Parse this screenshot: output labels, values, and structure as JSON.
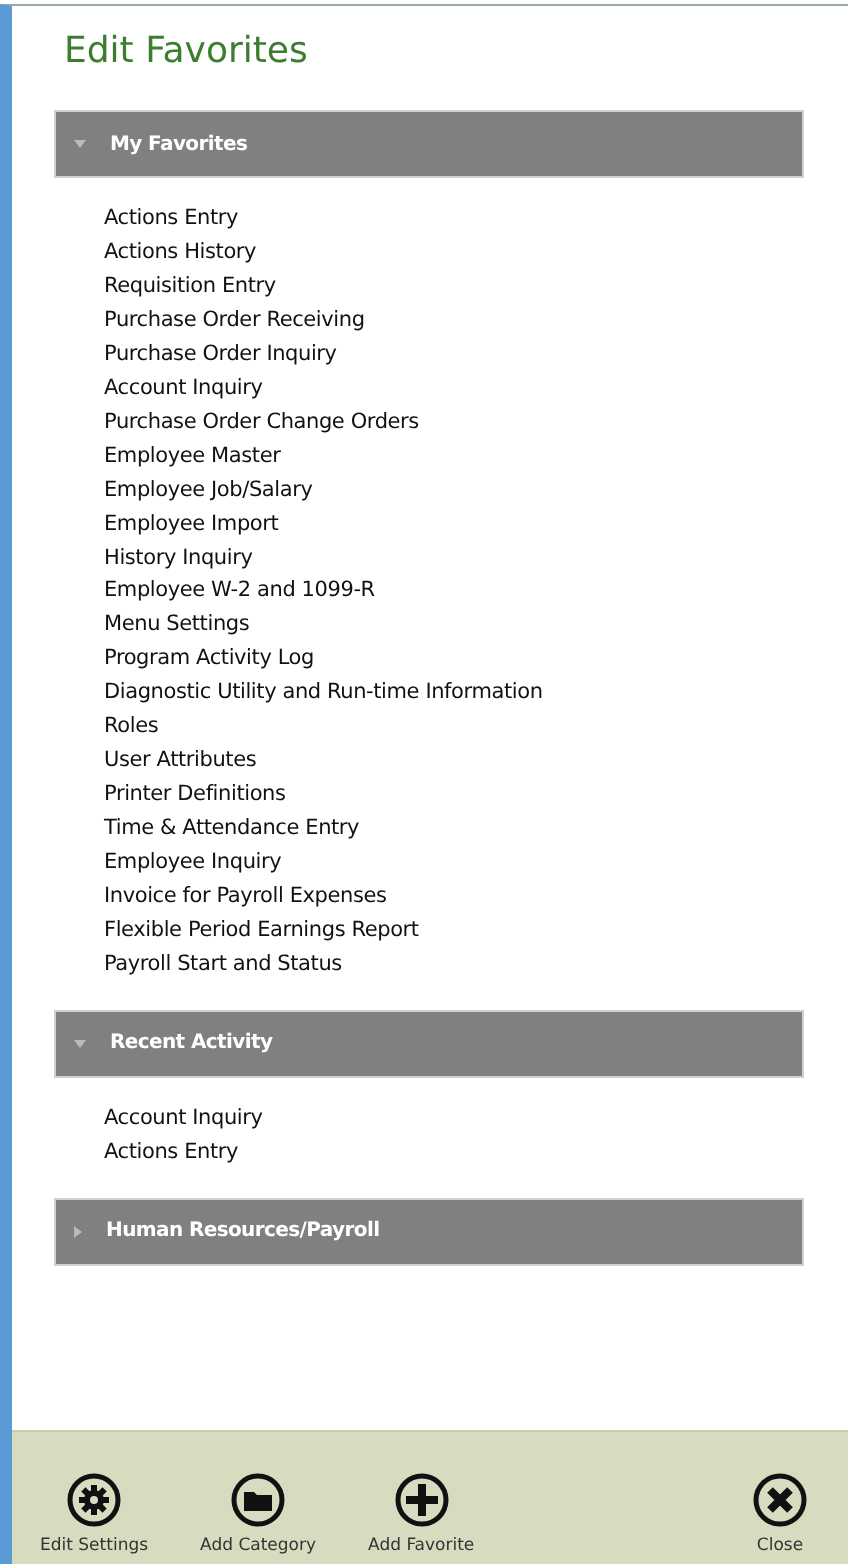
{
  "title": "Edit Favorites",
  "sections": [
    {
      "title": "My Favorites",
      "expanded": true,
      "items": [
        "Actions Entry",
        "Actions History",
        "Requisition Entry",
        "Purchase Order Receiving",
        "Purchase Order Inquiry",
        "Account Inquiry",
        "Purchase Order Change Orders",
        "Employee Master",
        "Employee Job/Salary",
        "Employee Import",
        "History Inquiry",
        "Employee W-2 and 1099-R",
        "Menu Settings",
        "Program Activity Log",
        "Diagnostic Utility and Run-time Information",
        "Roles",
        "User Attributes",
        "Printer Definitions",
        "Time & Attendance Entry",
        "Employee Inquiry",
        "Invoice for Payroll Expenses",
        "Flexible Period Earnings Report",
        "Payroll Start and Status"
      ]
    },
    {
      "title": "Recent Activity",
      "expanded": true,
      "items": [
        "Account Inquiry",
        "Actions Entry"
      ]
    },
    {
      "title": "Human Resources/Payroll",
      "expanded": false
    }
  ],
  "toolbar": [
    {
      "kind": "settings",
      "label": "Edit Settings"
    },
    {
      "kind": "folder",
      "label": "Add Category"
    },
    {
      "kind": "add",
      "label": "Add Favorite"
    },
    {
      "kind": "close",
      "label": "Close"
    }
  ]
}
